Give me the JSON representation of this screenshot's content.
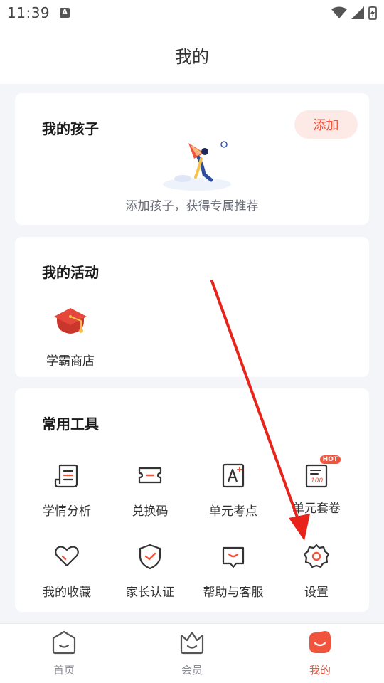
{
  "status_bar": {
    "time": "11:39",
    "indicator": "A"
  },
  "header": {
    "title": "我的"
  },
  "children_card": {
    "title": "我的孩子",
    "add_button": "添加",
    "caption": "添加孩子，获得专属推荐"
  },
  "activity_card": {
    "title": "我的活动",
    "items": [
      {
        "label": "学霸商店",
        "icon": "graduation-cap-icon"
      }
    ]
  },
  "tools_card": {
    "title": "常用工具",
    "items": [
      {
        "label": "学情分析",
        "icon": "report-icon"
      },
      {
        "label": "兑换码",
        "icon": "ticket-icon"
      },
      {
        "label": "单元考点",
        "icon": "letter-a-icon"
      },
      {
        "label": "单元套卷",
        "icon": "exam-paper-icon",
        "badge": "HOT"
      },
      {
        "label": "我的收藏",
        "icon": "heart-icon"
      },
      {
        "label": "家长认证",
        "icon": "shield-check-icon"
      },
      {
        "label": "帮助与客服",
        "icon": "chat-smile-icon"
      },
      {
        "label": "设置",
        "icon": "gear-icon"
      }
    ]
  },
  "tab_bar": {
    "tabs": [
      {
        "label": "首页",
        "icon": "home-face-icon",
        "active": false
      },
      {
        "label": "会员",
        "icon": "crown-icon",
        "active": false
      },
      {
        "label": "我的",
        "icon": "profile-face-icon",
        "active": true
      }
    ]
  },
  "colors": {
    "accent": "#f0543c",
    "accent_light": "#fde9e6",
    "background": "#f4f5f8",
    "annotation_arrow": "#e8231a"
  }
}
